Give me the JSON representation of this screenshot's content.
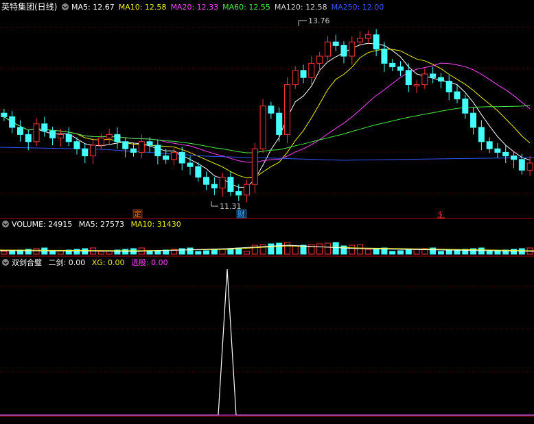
{
  "main": {
    "title": "英特集团(日线)",
    "ma": [
      {
        "label": "MA5: 12.67",
        "color": "#ffffff"
      },
      {
        "label": "MA10: 12.58",
        "color": "#f0f000"
      },
      {
        "label": "MA20: 12.33",
        "color": "#ff44ff"
      },
      {
        "label": "MA60: 12.55",
        "color": "#44ee44"
      },
      {
        "label": "MA120: 12.58",
        "color": "#d0d0d0"
      },
      {
        "label": "MA250: 12.00",
        "color": "#3355ff"
      }
    ],
    "high_label": "13.76",
    "low_label": "11.31",
    "markers": [
      {
        "text": "定",
        "color": "#ff6600"
      },
      {
        "text": "财",
        "color": "#44aaff"
      },
      {
        "text": "$",
        "color": "#ff3333"
      }
    ]
  },
  "volume": {
    "label": "VOLUME: 24915",
    "ma5": "MA5: 27573",
    "ma10": "MA10: 31430",
    "ma5_color": "#ffffff",
    "ma10_color": "#f0f000"
  },
  "indicator": {
    "name": "双剑合璧",
    "v1": "二剑: 0.00",
    "v2": "XG: 0.00",
    "v3": "选股: 0.00",
    "v2_color": "#f0f000",
    "v3_color": "#ff44ff"
  },
  "colors": {
    "up": "#ff3333",
    "down": "#44ffff",
    "grid": "#7a0000",
    "frame": "#b00000"
  }
}
